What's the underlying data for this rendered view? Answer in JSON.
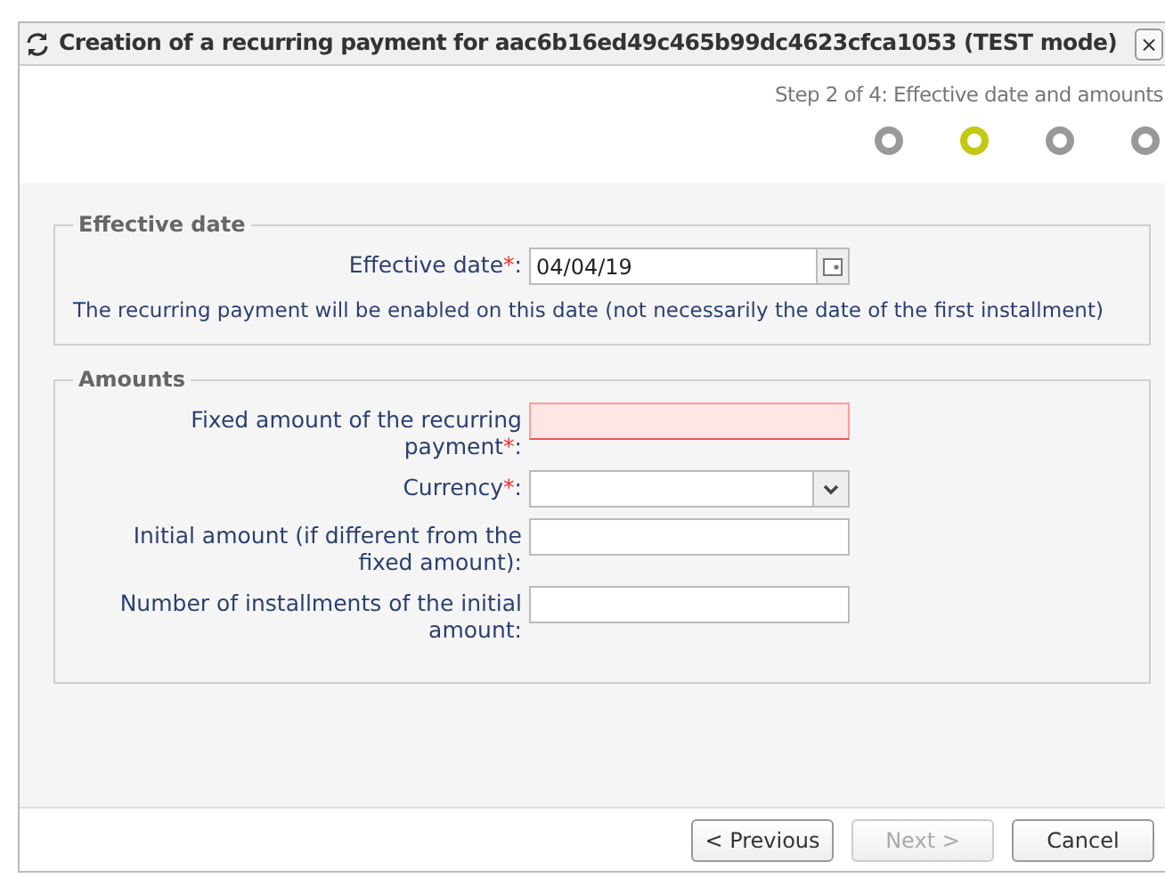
{
  "window": {
    "title": "Creation of a recurring payment for aac6b16ed49c465b99dc4623cfca1053 (TEST mode)",
    "close": "×"
  },
  "stepper": {
    "caption": "Step 2 of 4: Effective date and amounts",
    "steps": [
      {
        "selected": false
      },
      {
        "selected": true
      },
      {
        "selected": false
      },
      {
        "selected": false
      }
    ]
  },
  "sections": [
    {
      "legend": "Effective date",
      "fields": [
        {
          "kind": "date",
          "label": "Effective date",
          "required_mark": "*",
          "colon": ":",
          "value": "04/04/19",
          "invalid": false
        }
      ],
      "note": "The recurring payment will be enabled on this date (not necessarily the date of the first installment)"
    },
    {
      "legend": "Amounts",
      "fields": [
        {
          "kind": "text",
          "label": "Fixed amount of the recurring payment",
          "required_mark": "*",
          "colon": ":",
          "invalid": true
        },
        {
          "kind": "select",
          "label": "Currency",
          "required_mark": "*",
          "colon": ":",
          "invalid": false
        },
        {
          "kind": "text",
          "label": "Initial amount (if different from the fixed amount)",
          "colon": ":",
          "invalid": false
        },
        {
          "kind": "text",
          "label": "Number of installments of the initial amount",
          "colon": ":",
          "invalid": false
        }
      ]
    }
  ],
  "buttons": [
    {
      "label": "< Previous",
      "disabled": false
    },
    {
      "label": "Next >",
      "disabled": true
    },
    {
      "label": "Cancel",
      "disabled": false
    }
  ]
}
